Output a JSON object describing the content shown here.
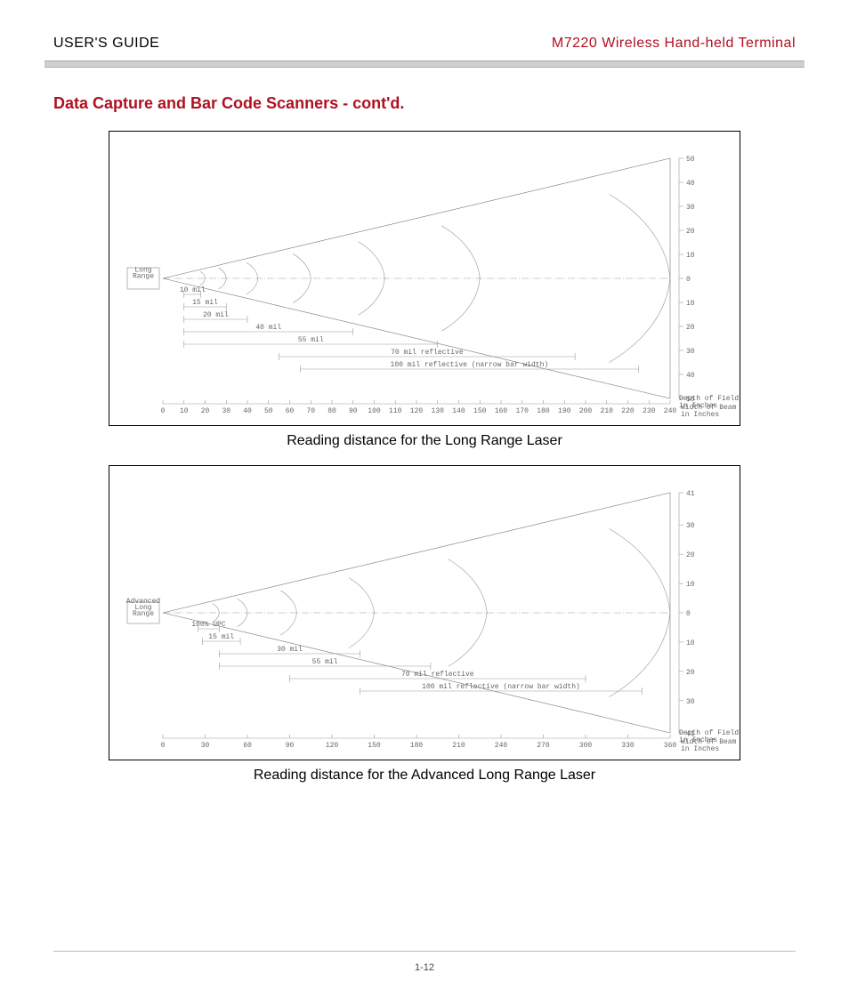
{
  "header": {
    "left": "USER'S GUIDE",
    "right": "M7220 Wireless Hand-held Terminal"
  },
  "section_title": "Data Capture and Bar Code Scanners - cont'd.",
  "figures": [
    {
      "caption": "Reading distance for the Long Range Laser"
    },
    {
      "caption": "Reading distance for the Advanced Long Range Laser"
    }
  ],
  "page_number": "1-12",
  "chart_data": [
    {
      "type": "area",
      "title": "Reading distance for the Long Range Laser",
      "emitter_label": "Long\nRange",
      "xlabel": "Depth of Field\nin Inches",
      "ylabel": "Width of Beam\nin Inches",
      "x_ticks": [
        0,
        10,
        20,
        30,
        40,
        50,
        60,
        70,
        80,
        90,
        100,
        110,
        120,
        130,
        140,
        150,
        160,
        170,
        180,
        190,
        200,
        210,
        220,
        230,
        240
      ],
      "y_ticks": [
        -50,
        -40,
        -30,
        -20,
        -10,
        0,
        10,
        20,
        30,
        40,
        50
      ],
      "xlim": [
        0,
        240
      ],
      "ylim": [
        -50,
        50
      ],
      "beam_envelope_half_width_at_x": {
        "0": 0,
        "240": 50
      },
      "series": [
        {
          "name": "10 mil",
          "x_range": [
            10,
            18
          ]
        },
        {
          "name": "15 mil",
          "x_range": [
            10,
            30
          ]
        },
        {
          "name": "20 mil",
          "x_range": [
            10,
            40
          ]
        },
        {
          "name": "40 mil",
          "x_range": [
            10,
            90
          ]
        },
        {
          "name": "55 mil",
          "x_range": [
            10,
            130
          ]
        },
        {
          "name": "70 mil reflective",
          "x_range": [
            55,
            195
          ]
        },
        {
          "name": "100 mil reflective (narrow bar width)",
          "x_range": [
            65,
            225
          ]
        }
      ],
      "lobes_end_x": [
        20,
        30,
        45,
        70,
        105,
        150,
        240
      ]
    },
    {
      "type": "area",
      "title": "Reading distance for the Advanced Long Range Laser",
      "emitter_label": "Advanced\nLong\nRange",
      "xlabel": "Depth of Field\nin Inches",
      "ylabel": "Width of Beam\nin Inches",
      "x_ticks": [
        0,
        30,
        60,
        90,
        120,
        150,
        180,
        210,
        240,
        270,
        300,
        330,
        360
      ],
      "y_ticks": [
        -41,
        -30,
        -20,
        -10,
        0,
        10,
        20,
        30,
        41
      ],
      "xlim": [
        0,
        360
      ],
      "ylim": [
        -41,
        41
      ],
      "beam_envelope_half_width_at_x": {
        "0": 0,
        "360": 41
      },
      "series": [
        {
          "name": "100% UPC",
          "x_range": [
            25,
            40
          ]
        },
        {
          "name": "15 mil",
          "x_range": [
            28,
            55
          ]
        },
        {
          "name": "30 mil",
          "x_range": [
            40,
            140
          ]
        },
        {
          "name": "55 mil",
          "x_range": [
            40,
            190
          ]
        },
        {
          "name": "70 mil reflective",
          "x_range": [
            90,
            300
          ]
        },
        {
          "name": "100 mil reflective (narrow bar width)",
          "x_range": [
            140,
            340
          ]
        }
      ],
      "lobes_end_x": [
        40,
        60,
        95,
        150,
        230,
        360
      ]
    }
  ]
}
